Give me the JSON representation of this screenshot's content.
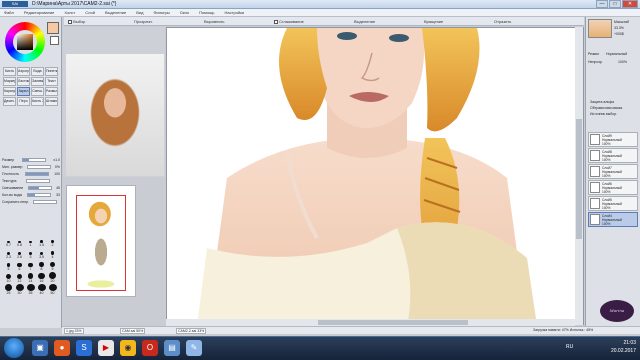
{
  "window": {
    "title": "D:\\Марина\\Арты 2017\\CAM2-2.sai (*)",
    "buttons": [
      "—",
      "□",
      "✕"
    ]
  },
  "menu": [
    "Файл",
    "Редактирование",
    "Холст",
    "Слой",
    "Выделение",
    "Вид",
    "Фильтры",
    "Окно",
    "Помощь",
    "Настройки"
  ],
  "toolbar": {
    "items": [
      "Выбор",
      "Прозрачн.",
      "Выровнять",
      "Сглаживание",
      "Выделение",
      "Вращение",
      "Отразить"
    ]
  },
  "tools": [
    "Кисть",
    "Аэрогр.",
    "Вода",
    "Пипетка",
    "Маркер",
    "Ластик",
    "Заливка",
    "Текст",
    "Карандаш",
    "Акрил",
    "Смеш.",
    "Размыт.",
    "Двоич.",
    "Перо",
    "Кисть 2",
    "Штамп"
  ],
  "brush_settings": [
    {
      "label": "Размер",
      "value": "x1.0",
      "fill": 0.3
    },
    {
      "label": "Мин. размер",
      "value": "0%",
      "fill": 0.0
    },
    {
      "label": "Плотность",
      "value": "100",
      "fill": 1.0
    },
    {
      "label": "Текстура",
      "value": "",
      "fill": 0.0
    },
    {
      "label": "Смешивание",
      "value": "45",
      "fill": 0.45
    },
    {
      "label": "Кол-во воды",
      "value": "33",
      "fill": 0.33
    },
    {
      "label": "Сохранить непр.",
      "value": "",
      "fill": 0.0
    }
  ],
  "brush_sizes": [
    "0.7",
    "0.8",
    "1",
    "1.5",
    "2",
    "2.3",
    "2.6",
    "3",
    "3.5",
    "4",
    "5",
    "6",
    "7",
    "8",
    "9",
    "10",
    "12",
    "14",
    "16",
    "20",
    "25",
    "30",
    "35",
    "40",
    "50"
  ],
  "right_panel": {
    "zoom_label": "Масштаб",
    "zoom_value": "33.3%",
    "angle_label": "Угол",
    "angle_value": "+000$",
    "mode_label": "Режим",
    "mode_value": "Нормальный",
    "opacity_label": "Непрозр.",
    "opacity_value": "100%",
    "options": [
      "Защита альфа",
      "Обтравочная маска",
      "Источник выбор."
    ]
  },
  "layers": [
    {
      "name": "Слой9",
      "mode": "Нормальный",
      "opacity": "100%"
    },
    {
      "name": "Слой8",
      "mode": "Нормальный",
      "opacity": "100%"
    },
    {
      "name": "Слой7",
      "mode": "Нормальный",
      "opacity": "100%"
    },
    {
      "name": "Слой6",
      "mode": "Нормальный",
      "opacity": "100%"
    },
    {
      "name": "Слой5",
      "mode": "Нормальный",
      "opacity": "100%"
    },
    {
      "name": "Слой4",
      "mode": "Нормальный",
      "opacity": "100%"
    }
  ],
  "status": {
    "docs": [
      "1.jpg 33%",
      "CAM.sai 50%",
      "CAM2-2.sai 33%"
    ],
    "memory": "Загрузка памяти: 47%  Использ.: 45%"
  },
  "watermark": "Marina",
  "taskbar": {
    "time": "21:03",
    "date": "20.02.2017",
    "lang": "RU"
  },
  "colors": {
    "accent": "#5b7db3",
    "skin": "#f4c9a4",
    "hair": "#e4a93a"
  }
}
